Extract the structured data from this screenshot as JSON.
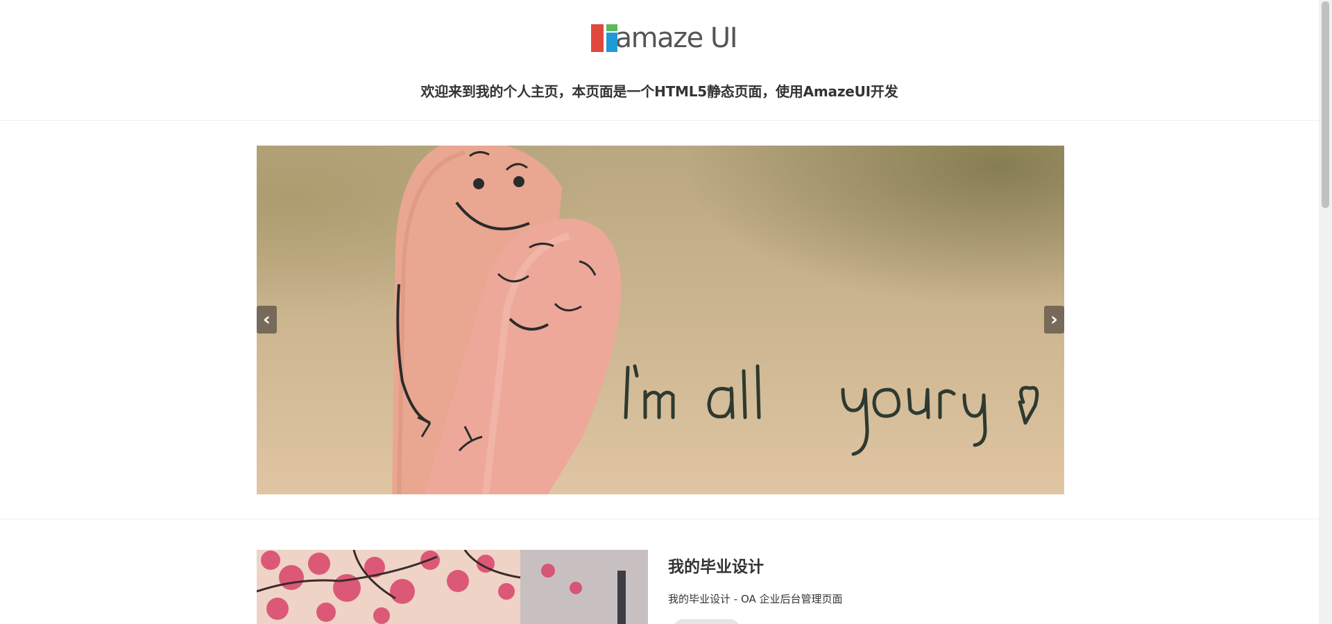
{
  "header": {
    "logo_text": "amaze UI",
    "welcome": "欢迎来到我的个人主页，本页面是一个HTML5静态页面，使用AmazeUI开发"
  },
  "slider": {
    "slide_caption": "I'm all yours",
    "prev_icon": "chevron-left-icon",
    "next_icon": "chevron-right-icon",
    "prev_glyph": "‹",
    "next_glyph": "›"
  },
  "project": {
    "title": "我的毕业设计",
    "description": "我的毕业设计 - OA 企业后台管理页面"
  },
  "colors": {
    "logo_red": "#e0473d",
    "logo_green": "#5cb85c",
    "logo_blue": "#1e9bd7",
    "text": "#333333"
  }
}
